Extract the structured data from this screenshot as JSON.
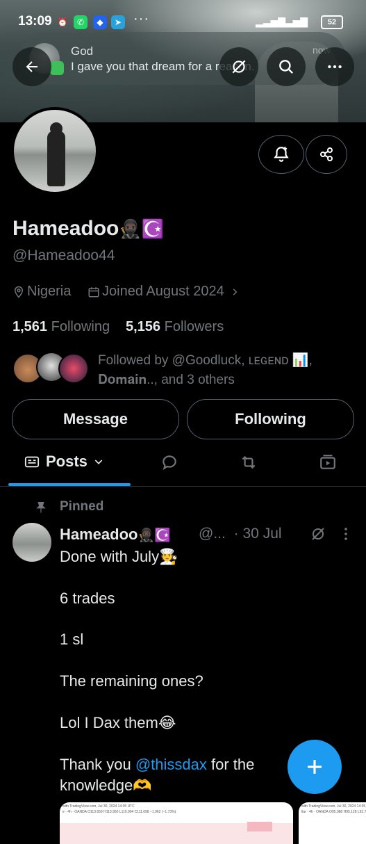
{
  "status_bar": {
    "time": "13:09",
    "more": "···",
    "battery": "52"
  },
  "notification": {
    "title": "God",
    "text": "I gave you that dream for a reason.",
    "time": "now"
  },
  "profile": {
    "name": "Hameadoo",
    "name_emoji": "🥷🏿☪️",
    "handle": "@Hameadoo44",
    "location": "Nigeria",
    "joined": "Joined August 2024",
    "following_count": "1,561",
    "following_label": "Following",
    "followers_count": "5,156",
    "followers_label": "Followers",
    "followed_by_line1": "Followed by @Goodluck, ʟᴇɢᴇɴᴅ 📊,",
    "followed_by_line2": "𝐃𝐨𝐦𝐚𝐢𝐧.., and 3 others"
  },
  "actions": {
    "message": "Message",
    "following": "Following"
  },
  "tabs": {
    "posts": "Posts"
  },
  "post": {
    "pinned_label": "Pinned",
    "author": "Hameadoo",
    "author_emoji": "🥷🏿☪️",
    "handle_short": "@...",
    "date": "· 30 Jul",
    "lines": [
      "Done with July🧑‍🍳",
      "6 trades",
      "1 sl",
      "The remaining ones?",
      "Lol I Dax them😂"
    ],
    "thanks_prefix": "Thank you ",
    "mention": "@thissdax",
    "thanks_suffix": " for the",
    "last_line": "knowledge🫶"
  },
  "media": {
    "chart1_header": "with TradingView.com, Jul 30, 2024 14:35 UTC",
    "chart1_sub": "e · 4h · OANDA  O113.659 H113.950 L110.904 C111.698 −1.962 (−1.73%)",
    "chart2_header": "with TradingView.com, Jul 30, 2024 14:35 UTC",
    "chart2_sub": "llar · 4h · OANDA  O95.088 H95.128 L92.76"
  },
  "colors": {
    "accent": "#1d9bf0",
    "muted": "#71767b",
    "border": "#536471"
  },
  "icons": [
    "back-arrow-icon",
    "grok-icon",
    "search-icon",
    "more-icon",
    "notification-bell-icon",
    "share-icon",
    "location-icon",
    "calendar-icon",
    "chevron-right-icon",
    "posts-tab-icon",
    "chevron-down-icon",
    "replies-icon",
    "reposts-icon",
    "media-icon",
    "pin-icon",
    "plus-icon"
  ]
}
